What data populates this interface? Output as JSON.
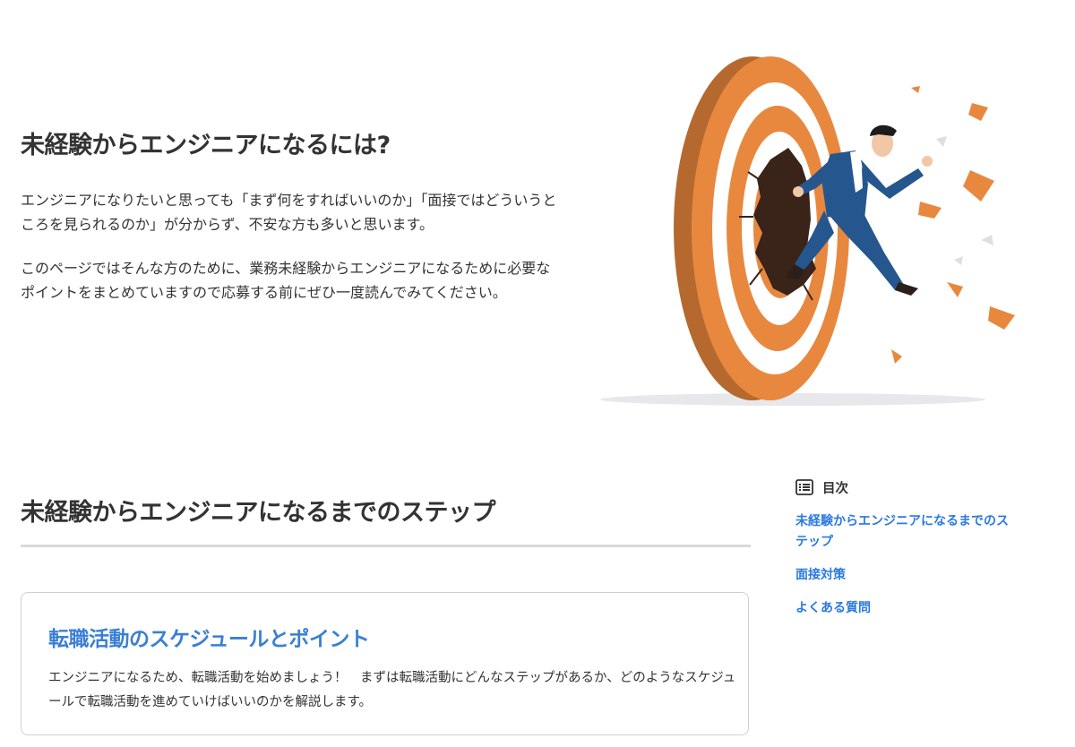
{
  "hero": {
    "title": "未経験からエンジニアになるには?",
    "paragraph1": "エンジニアになりたいと思っても「まず何をすればいいのか」「面接ではどういうところを見られるのか」が分からず、不安な方も多いと思います。",
    "paragraph2": "このページではそんな方のために、業務未経験からエンジニアになるために必要なポイントをまとめていますので応募する前にぜひ一度読んでみてください。",
    "illustration": "man-breaking-through-target-illustration"
  },
  "steps": {
    "title": "未経験からエンジニアになるまでのステップ",
    "card": {
      "title": "転職活動のスケジュールとポイント",
      "description": "エンジニアになるため、転職活動を始めましょう！　まずは転職活動にどんなステップがあるか、どのようなスケジュールで転職活動を進めていけばいいのかを解説します。"
    }
  },
  "toc": {
    "icon": "list-icon",
    "heading": "目次",
    "items": [
      {
        "label": "未経験からエンジニアになるまでのステップ"
      },
      {
        "label": "面接対策"
      },
      {
        "label": "よくある質問"
      }
    ]
  },
  "colors": {
    "text": "#333333",
    "link": "#2a7ae2",
    "card_title": "#3a7fd5",
    "target_orange": "#e8883f",
    "suit_blue": "#25578e"
  }
}
